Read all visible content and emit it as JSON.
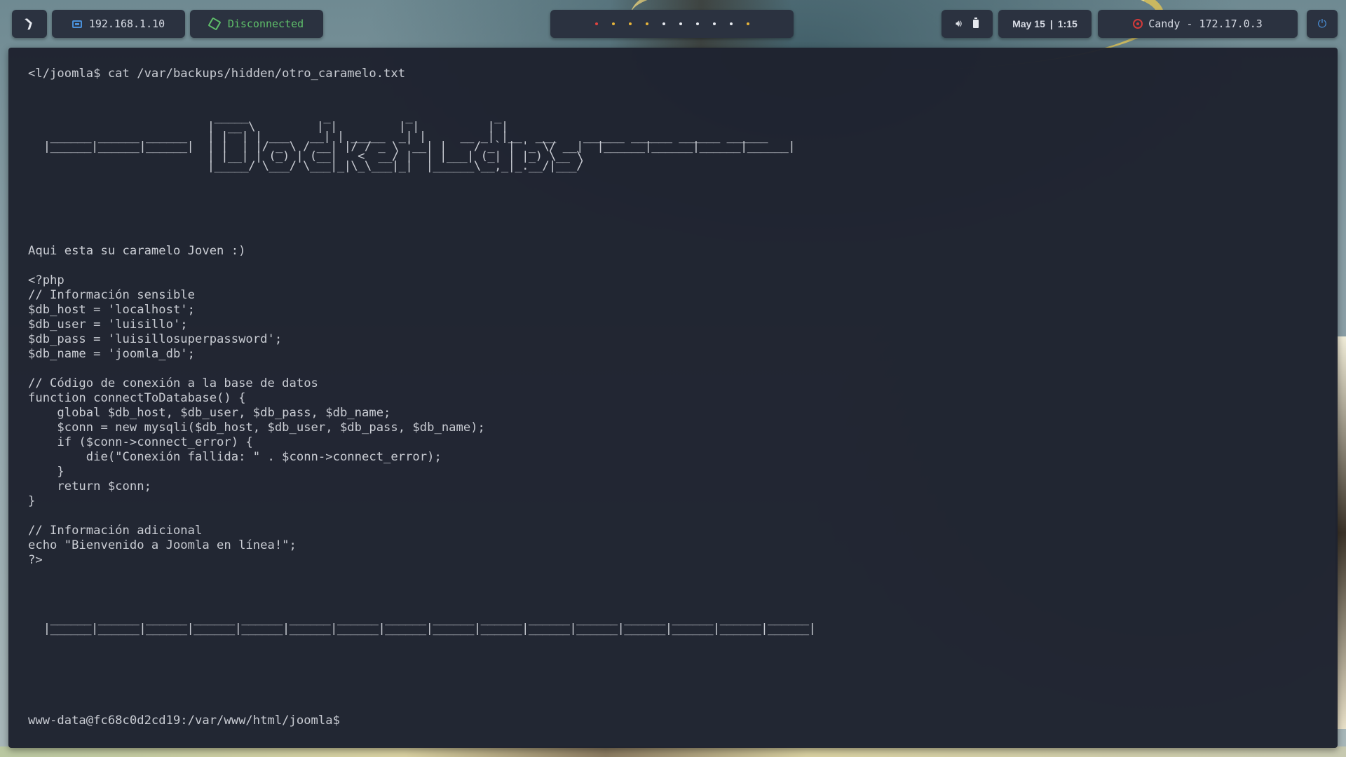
{
  "topbar": {
    "logo_icon": "parrot-logo-icon",
    "ip": "192.168.1.10",
    "vpn_status": "Disconnected",
    "workspace_dots": [
      "#e0433f",
      "#e6b43a",
      "#e6b43a",
      "#e6b43a",
      "#e6e9ef",
      "#e6e9ef",
      "#e6e9ef",
      "#e6e9ef",
      "#e6e9ef",
      "#e6b43a"
    ],
    "date": "May 15",
    "time": "1:15",
    "target": "Candy - 172.17.0.3"
  },
  "colors": {
    "ip_icon": "#4a90d9",
    "vpn_text": "#5fbf6a",
    "target_icon": "#d23a3a",
    "terminal_bg": "#1e222e",
    "terminal_text": "#c9ccd3"
  },
  "terminal": {
    "command_line": "<l/joomla$ cat /var/backups/hidden/otro_caramelo.txt",
    "banner_art": "                          _____           _           _            _\n                         |  __ \\         | |         | |          | |\n  ______ ______ ______   | |  | | ___   __| | _____  _| |     __ _| |__  ___    ______ ______ ______ ______\n |______|______|______|  | |  | |/ _ \\ / __| |/ / _ \\ '__| |    / _` | '_ \\/ __|  |______|______|______|______|\n                         | |__| | (_) | (__|   <  __/ |  | |___| (_| | |_) \\__ \\\n                         |_____/ \\___/ \\___|_|\\_\\___|_|  |______\\__,_|_.__/|___/",
    "message": "Aqui esta su caramelo Joven :)",
    "code": "<?php\n// Información sensible\n$db_host = 'localhost';\n$db_user = 'luisillo';\n$db_pass = 'luisillosuperpassword';\n$db_name = 'joomla_db';\n\n// Código de conexión a la base de datos\nfunction connectToDatabase() {\n    global $db_host, $db_user, $db_pass, $db_name;\n    $conn = new mysqli($db_host, $db_user, $db_pass, $db_name);\n    if ($conn->connect_error) {\n        die(\"Conexión fallida: \" . $conn->connect_error);\n    }\n    return $conn;\n}\n\n// Información adicional\necho \"Bienvenido a Joomla en línea!\";\n?>",
    "footer_art": "  ______ ______ ______ ______ ______ ______ ______ ______ ______ ______ ______ ______ ______ ______ ______ ______\n |______|______|______|______|______|______|______|______|______|______|______|______|______|______|______|______|",
    "prompt": "www-data@fc68c0d2cd19:/var/www/html/joomla$"
  }
}
